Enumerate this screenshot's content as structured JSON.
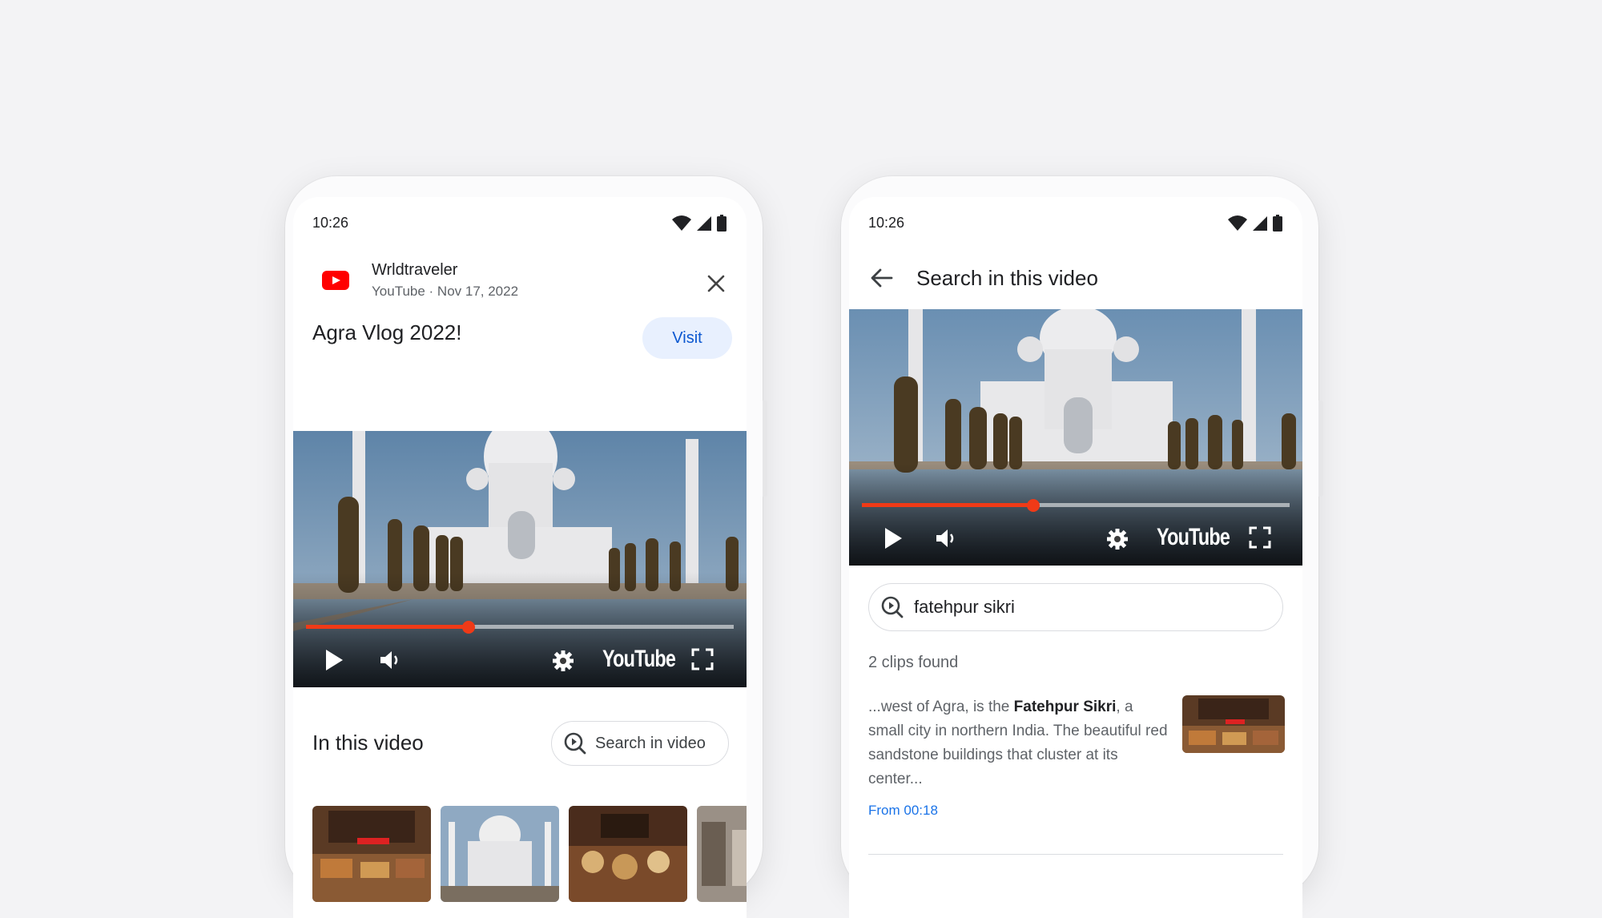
{
  "status_bar": {
    "time": "10:26"
  },
  "left_phone": {
    "channel_name": "Wrldtraveler",
    "channel_meta": "YouTube · Nov 17, 2022",
    "video_title": "Agra Vlog 2022!",
    "visit_label": "Visit",
    "player": {
      "progress_fraction": 0.38,
      "brand": "YouTube"
    },
    "section_title": "In this video",
    "search_button_label": "Search in video"
  },
  "right_phone": {
    "header_title": "Search in this video",
    "player": {
      "progress_fraction": 0.4,
      "brand": "YouTube"
    },
    "search": {
      "value": "fatehpur sikri"
    },
    "results_count": "2 clips found",
    "result": {
      "text_before": "...west of Agra, is the ",
      "text_bold": "Fatehpur Sikri",
      "text_after": ", a small city in northern India. The beautiful red sandstone buildings that cluster at its center...",
      "timestamp": "From 00:18"
    }
  },
  "colors": {
    "youtube_red": "#ff0000",
    "visit_bg": "#e8f0fe",
    "visit_text": "#0b57d0",
    "link_blue": "#1a73e8",
    "progress_red": "#f03a17"
  }
}
